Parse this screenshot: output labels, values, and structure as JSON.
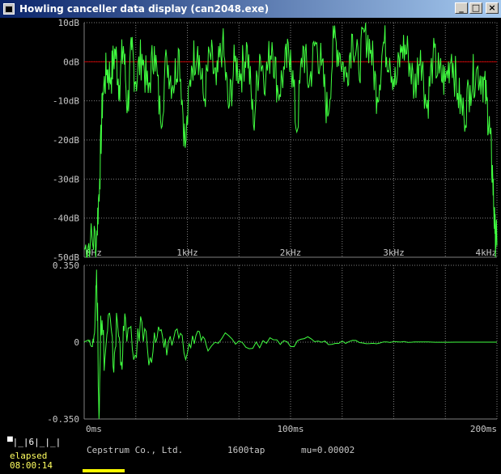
{
  "window": {
    "title": "Howling canceller data display (can2048.exe)",
    "buttons": {
      "minimize": "_",
      "maximize": "□",
      "close": "×"
    }
  },
  "status": {
    "mode_indicator": "▀|_|6|_|_|",
    "elapsed_label": "elapsed",
    "elapsed_time": "08:00:14",
    "company": "Cepstrum Co., Ltd.",
    "taps": "1600tap",
    "mu": "mu=0.00002"
  },
  "colors": {
    "trace": "#40ff40",
    "reference_line": "#c00000",
    "grid": "#808080",
    "axis_text": "#c8c8c8",
    "elapsed_text": "#ffff60"
  },
  "chart_data": [
    {
      "type": "line",
      "title": "",
      "xlabel": "",
      "ylabel": "",
      "x_unit": "Hz",
      "xlim": [
        0,
        4000
      ],
      "ylim": [
        -50,
        10
      ],
      "x_ticks": [
        0,
        1000,
        2000,
        3000,
        4000
      ],
      "x_tick_labels": [
        "0Hz",
        "1kHz",
        "2kHz",
        "3kHz",
        "4kHz"
      ],
      "y_ticks": [
        10,
        0,
        -10,
        -20,
        -30,
        -40,
        -50
      ],
      "y_tick_labels": [
        "10dB",
        "0dB",
        "-10dB",
        "-20dB",
        "-30dB",
        "-40dB",
        "-50dB"
      ],
      "reference_line_y": 0,
      "grid": true,
      "series": [
        {
          "x": [
            0,
            60,
            120,
            150,
            180,
            220,
            260,
            300,
            340,
            380,
            420,
            460,
            500,
            560,
            620,
            680,
            740,
            800,
            860,
            920,
            980,
            1040,
            1100,
            1160,
            1220,
            1280,
            1340,
            1400,
            1460,
            1520,
            1580,
            1640,
            1700,
            1760,
            1820,
            1880,
            1940,
            2000,
            2060,
            2120,
            2180,
            2240,
            2300,
            2360,
            2420,
            2480,
            2540,
            2600,
            2660,
            2720,
            2780,
            2840,
            2900,
            2960,
            3020,
            3080,
            3140,
            3200,
            3260,
            3320,
            3380,
            3440,
            3500,
            3560,
            3620,
            3680,
            3740,
            3800,
            3860,
            3900,
            3930,
            3960,
            3980,
            4000
          ],
          "values": [
            -48,
            -46,
            -45,
            -30,
            -8,
            -2,
            -4,
            3,
            -6,
            4,
            -12,
            3,
            -5,
            2,
            -8,
            4,
            -15,
            1,
            -6,
            3,
            -22,
            -1,
            4,
            -10,
            2,
            -6,
            5,
            -12,
            0,
            -3,
            4,
            -16,
            2,
            -4,
            5,
            -8,
            -2,
            3,
            -18,
            4,
            -6,
            5,
            -1,
            -14,
            6,
            2,
            -4,
            7,
            -2,
            8,
            3,
            -9,
            5,
            1,
            -6,
            4,
            2,
            -7,
            3,
            -12,
            1,
            -3,
            -5,
            2,
            -8,
            -14,
            -6,
            -2,
            -4,
            -10,
            -18,
            -30,
            -44,
            -47
          ]
        }
      ]
    },
    {
      "type": "line",
      "title": "",
      "xlabel": "",
      "ylabel": "",
      "x_unit": "ms",
      "xlim": [
        0,
        200
      ],
      "ylim": [
        -0.35,
        0.35
      ],
      "x_ticks": [
        0,
        100,
        200
      ],
      "x_tick_labels": [
        "0ms",
        "100ms",
        "200ms"
      ],
      "y_ticks": [
        0.35,
        0,
        -0.35
      ],
      "y_tick_labels": [
        "0.350",
        "0",
        "-0.350"
      ],
      "grid": true,
      "series": [
        {
          "x": [
            0,
            2,
            4,
            5,
            6,
            7,
            8,
            10,
            12,
            14,
            16,
            18,
            20,
            24,
            28,
            32,
            36,
            40,
            45,
            50,
            55,
            60,
            70,
            80,
            90,
            100,
            110,
            120,
            130,
            140,
            150,
            160,
            180,
            200
          ],
          "values": [
            0,
            0.01,
            -0.02,
            0.04,
            0.33,
            -0.25,
            0.12,
            -0.08,
            0.13,
            -0.11,
            0.1,
            -0.09,
            0.11,
            -0.08,
            0.09,
            -0.07,
            0.07,
            -0.06,
            0.06,
            -0.05,
            0.05,
            -0.04,
            0.03,
            -0.03,
            0.02,
            -0.02,
            0.015,
            -0.01,
            0.008,
            -0.005,
            0.003,
            0.001,
            0,
            0
          ]
        }
      ]
    }
  ]
}
